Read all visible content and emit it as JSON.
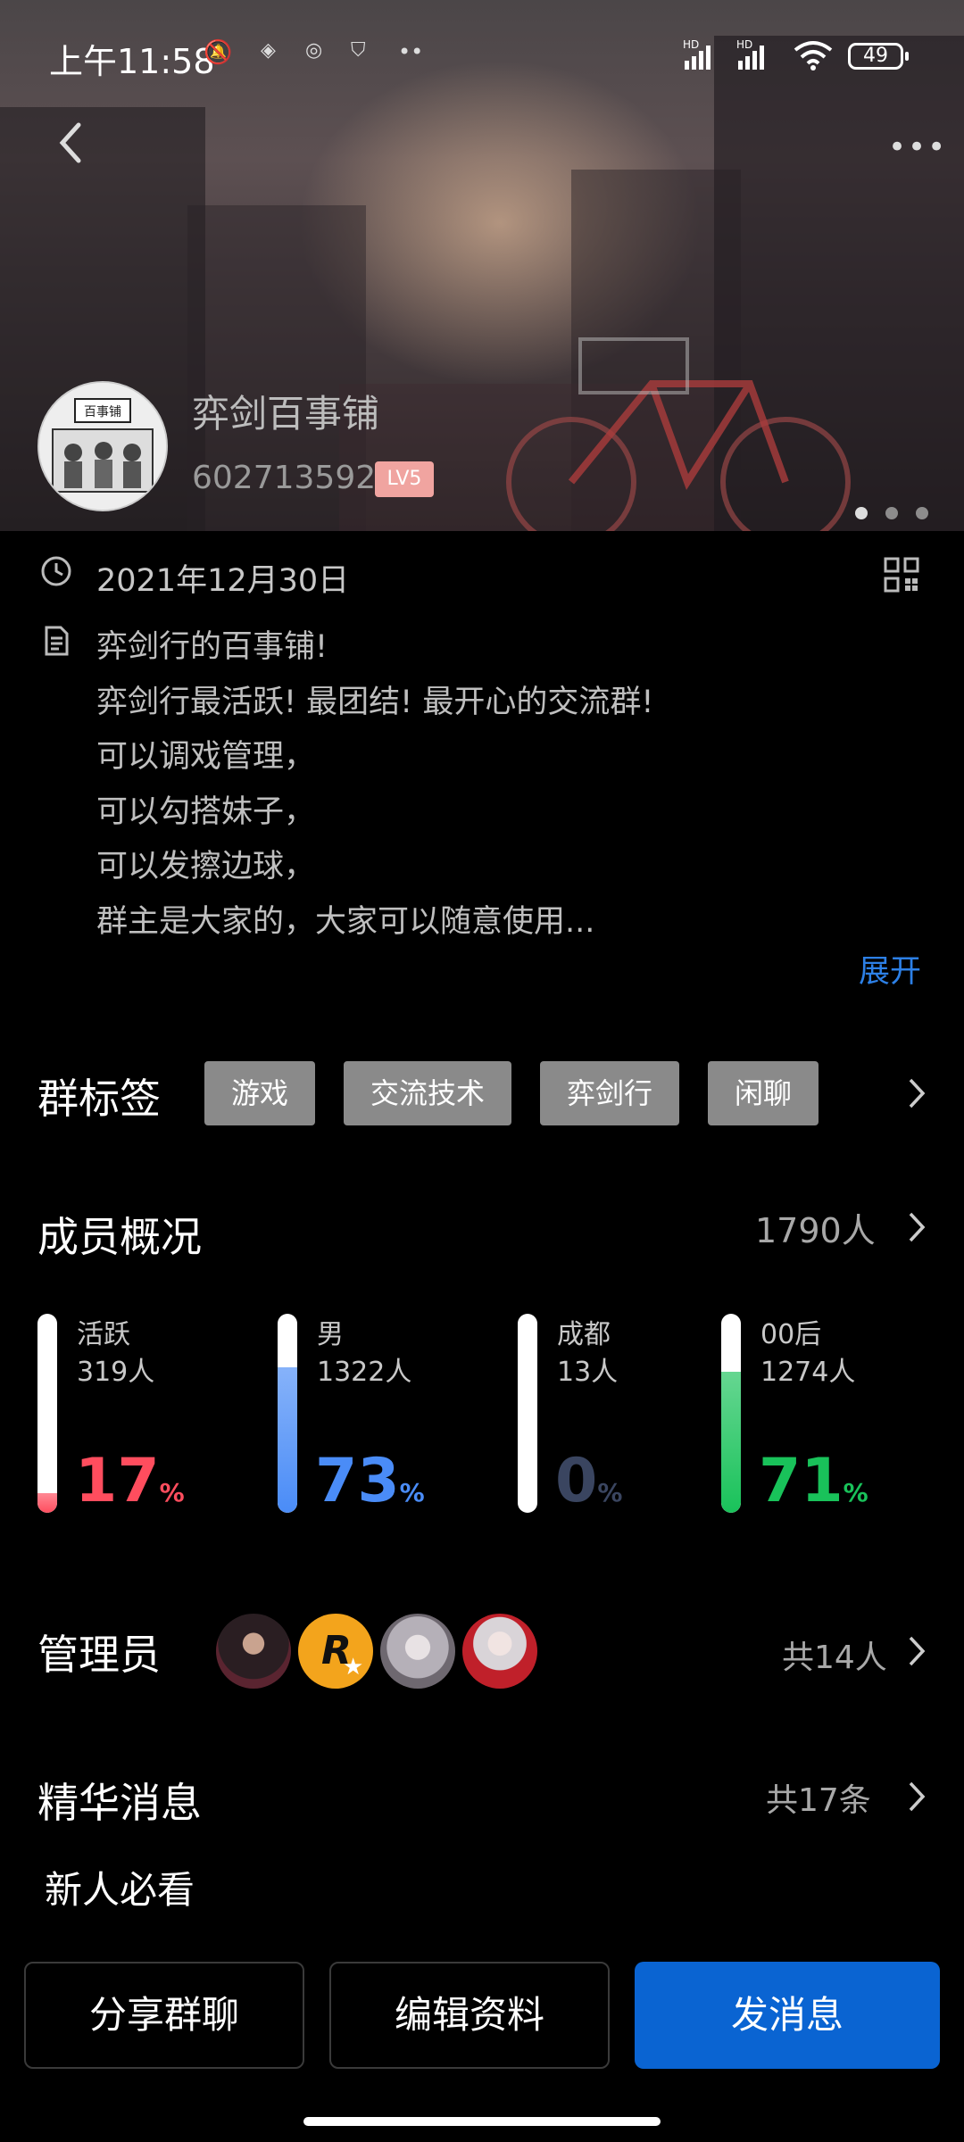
{
  "status_bar": {
    "time": "上午11:58",
    "battery": "49",
    "signal": "HD"
  },
  "header": {
    "group_name": "弈剑百事铺",
    "group_id": "602713592",
    "level": "LV5"
  },
  "info": {
    "created_date": "2021年12月30日",
    "description_lines": [
      "弈剑行的百事铺!",
      "弈剑行最活跃! 最团结! 最开心的交流群!",
      "可以调戏管理，",
      "可以勾搭妹子，",
      "可以发擦边球，",
      "群主是大家的，大家可以随意使用..."
    ],
    "expand_label": "展开"
  },
  "tags": {
    "title": "群标签",
    "items": [
      "游戏",
      "交流技术",
      "弈剑行",
      "闲聊"
    ]
  },
  "members": {
    "title": "成员概况",
    "count": "1790人",
    "stats": [
      {
        "label": "活跃",
        "sub": "319人",
        "percent": "17",
        "fill": 0.1,
        "color": "#ff4d5e"
      },
      {
        "label": "男",
        "sub": "1322人",
        "percent": "73",
        "fill": 0.73,
        "color": "#4a8cf7"
      },
      {
        "label": "成都",
        "sub": "13人",
        "percent": "0",
        "fill": 0.0,
        "color": "#3a4560"
      },
      {
        "label": "00后",
        "sub": "1274人",
        "percent": "71",
        "fill": 0.71,
        "color": "#19c25a"
      }
    ],
    "pct_sign": "%"
  },
  "admins": {
    "title": "管理员",
    "count": "共14人"
  },
  "essence": {
    "title": "精华消息",
    "count": "共17条",
    "item": "新人必看"
  },
  "actions": {
    "share": "分享群聊",
    "edit": "编辑资料",
    "send": "发消息"
  }
}
